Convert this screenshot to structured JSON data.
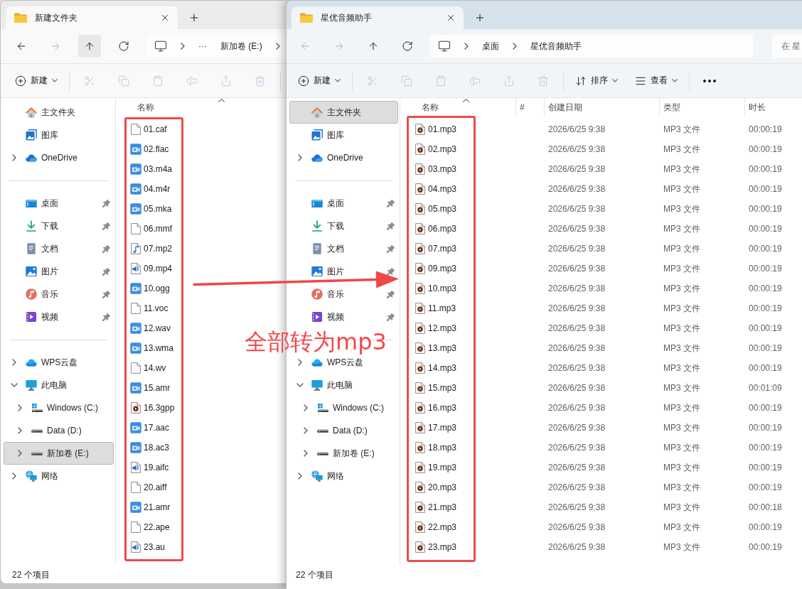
{
  "windows": [
    {
      "active": false,
      "tabs": [
        {
          "title": "新建文件夹",
          "selected": true
        }
      ],
      "nav_buttons": [
        {
          "kind": "back",
          "disabled": false,
          "hovered": false
        },
        {
          "kind": "forward",
          "disabled": true,
          "hovered": false
        },
        {
          "kind": "up",
          "disabled": false,
          "hovered": true
        },
        {
          "kind": "refresh",
          "disabled": false,
          "hovered": false
        }
      ],
      "address": [
        {
          "kind": "computer"
        },
        {
          "kind": "chevron"
        },
        {
          "kind": "overflow",
          "label": "···"
        },
        {
          "kind": "crumb",
          "label": "新加卷 (E:)"
        },
        {
          "kind": "chevron"
        }
      ],
      "command_bar": [
        {
          "kind": "new",
          "label": "新建",
          "disabled": false
        },
        {
          "kind": "separator"
        },
        {
          "kind": "cut",
          "disabled": true
        },
        {
          "kind": "copy",
          "disabled": true
        },
        {
          "kind": "paste",
          "disabled": true
        },
        {
          "kind": "rename",
          "disabled": true
        },
        {
          "kind": "share",
          "disabled": true
        },
        {
          "kind": "delete",
          "disabled": true
        },
        {
          "kind": "separator"
        }
      ],
      "sidebar": [
        {
          "items": [
            {
              "label": "主文件夹",
              "kind": "home",
              "selected": false
            },
            {
              "label": "图库",
              "kind": "gallery",
              "selected": false
            },
            {
              "label": "OneDrive",
              "kind": "onedrive",
              "selected": false,
              "expanded": false
            }
          ]
        },
        {
          "items": [
            {
              "label": "桌面",
              "kind": "desktop",
              "selected": false,
              "pinned": true
            },
            {
              "label": "下载",
              "kind": "downloads",
              "selected": false,
              "pinned": true
            },
            {
              "label": "文档",
              "kind": "documents",
              "selected": false,
              "pinned": true
            },
            {
              "label": "图片",
              "kind": "pictures",
              "selected": false,
              "pinned": true
            },
            {
              "label": "音乐",
              "kind": "music",
              "selected": false,
              "pinned": true
            },
            {
              "label": "视频",
              "kind": "videos",
              "selected": false,
              "pinned": true
            }
          ]
        },
        {
          "items": [
            {
              "label": "WPS云盘",
              "kind": "wps-cloud",
              "selected": false,
              "expanded": false
            },
            {
              "label": "此电脑",
              "kind": "pc",
              "selected": false,
              "expanded": true,
              "children": [
                {
                  "label": "Windows (C:)",
                  "kind": "system-drive",
                  "selected": false,
                  "expanded": false
                },
                {
                  "label": "Data (D:)",
                  "kind": "drive",
                  "selected": false,
                  "expanded": false
                },
                {
                  "label": "新加卷 (E:)",
                  "kind": "drive",
                  "selected": true,
                  "expanded": false
                }
              ]
            },
            {
              "label": "网络",
              "kind": "network",
              "selected": false,
              "expanded": false
            }
          ]
        }
      ],
      "file_list": {
        "name_column_marked": true,
        "columns": [
          {
            "kind": "name",
            "label": "名称",
            "sorted": true
          }
        ],
        "files": [
          {
            "name": "01.caf",
            "kind": "blank"
          },
          {
            "name": "02.flac",
            "kind": "media"
          },
          {
            "name": "03.m4a",
            "kind": "media"
          },
          {
            "name": "04.m4r",
            "kind": "media"
          },
          {
            "name": "05.mka",
            "kind": "media"
          },
          {
            "name": "06.mmf",
            "kind": "blank"
          },
          {
            "name": "07.mp2",
            "kind": "note"
          },
          {
            "name": "09.mp4",
            "kind": "speaker"
          },
          {
            "name": "10.ogg",
            "kind": "media"
          },
          {
            "name": "11.voc",
            "kind": "blank"
          },
          {
            "name": "12.wav",
            "kind": "media"
          },
          {
            "name": "13.wma",
            "kind": "media"
          },
          {
            "name": "14.wv",
            "kind": "blank"
          },
          {
            "name": "15.amr",
            "kind": "media"
          },
          {
            "name": "16.3gpp",
            "kind": "player"
          },
          {
            "name": "17.aac",
            "kind": "media"
          },
          {
            "name": "18.ac3",
            "kind": "media"
          },
          {
            "name": "19.aifc",
            "kind": "speaker"
          },
          {
            "name": "20.aiff",
            "kind": "blank"
          },
          {
            "name": "21.amr",
            "kind": "media"
          },
          {
            "name": "22.ape",
            "kind": "blank"
          },
          {
            "name": "23.au",
            "kind": "speaker"
          }
        ]
      },
      "status": "22 个项目"
    },
    {
      "active": true,
      "tabs": [
        {
          "title": "星优音频助手",
          "selected": true
        }
      ],
      "nav_buttons": [
        {
          "kind": "back",
          "disabled": true,
          "hovered": false
        },
        {
          "kind": "forward",
          "disabled": true,
          "hovered": false
        },
        {
          "kind": "up",
          "disabled": false,
          "hovered": false
        },
        {
          "kind": "refresh",
          "disabled": false,
          "hovered": false
        }
      ],
      "address": [
        {
          "kind": "computer"
        },
        {
          "kind": "chevron"
        },
        {
          "kind": "crumb",
          "label": "桌面"
        },
        {
          "kind": "chevron"
        },
        {
          "kind": "crumb",
          "label": "星优音频助手"
        }
      ],
      "search": {
        "placeholder": "在 星"
      },
      "command_bar": [
        {
          "kind": "new",
          "label": "新建",
          "disabled": false
        },
        {
          "kind": "separator"
        },
        {
          "kind": "cut",
          "disabled": true
        },
        {
          "kind": "copy",
          "disabled": true
        },
        {
          "kind": "paste",
          "disabled": true
        },
        {
          "kind": "rename",
          "disabled": true
        },
        {
          "kind": "share",
          "disabled": true
        },
        {
          "kind": "delete",
          "disabled": true
        },
        {
          "kind": "separator"
        },
        {
          "kind": "sort",
          "label": "排序",
          "disabled": false
        },
        {
          "kind": "view",
          "label": "查看",
          "disabled": false
        },
        {
          "kind": "separator"
        },
        {
          "kind": "more",
          "disabled": false
        }
      ],
      "sidebar": [
        {
          "items": [
            {
              "label": "主文件夹",
              "kind": "home",
              "selected": true
            },
            {
              "label": "图库",
              "kind": "gallery",
              "selected": false
            },
            {
              "label": "OneDrive",
              "kind": "onedrive",
              "selected": false,
              "expanded": false
            }
          ]
        },
        {
          "items": [
            {
              "label": "桌面",
              "kind": "desktop",
              "selected": false,
              "pinned": true
            },
            {
              "label": "下载",
              "kind": "downloads",
              "selected": false,
              "pinned": true
            },
            {
              "label": "文档",
              "kind": "documents",
              "selected": false,
              "pinned": true
            },
            {
              "label": "图片",
              "kind": "pictures",
              "selected": false,
              "pinned": true
            },
            {
              "label": "音乐",
              "kind": "music",
              "selected": false,
              "pinned": true
            },
            {
              "label": "视频",
              "kind": "videos",
              "selected": false,
              "pinned": true
            }
          ]
        },
        {
          "items": [
            {
              "label": "WPS云盘",
              "kind": "wps-cloud",
              "selected": false,
              "expanded": false
            },
            {
              "label": "此电脑",
              "kind": "pc",
              "selected": false,
              "expanded": true,
              "children": [
                {
                  "label": "Windows (C:)",
                  "kind": "system-drive",
                  "selected": false,
                  "expanded": false
                },
                {
                  "label": "Data (D:)",
                  "kind": "drive",
                  "selected": false,
                  "expanded": false
                },
                {
                  "label": "新加卷 (E:)",
                  "kind": "drive",
                  "selected": false,
                  "expanded": false
                }
              ]
            },
            {
              "label": "网络",
              "kind": "network",
              "selected": false,
              "expanded": false
            }
          ]
        }
      ],
      "file_list": {
        "name_column_marked": true,
        "columns": [
          {
            "kind": "name",
            "label": "名称",
            "sorted": true
          },
          {
            "kind": "number",
            "label": "#",
            "sorted": false
          },
          {
            "kind": "text",
            "label": "创建日期",
            "sorted": false
          },
          {
            "kind": "text",
            "label": "类型",
            "sorted": false
          },
          {
            "kind": "text",
            "label": "时长",
            "sorted": false
          }
        ],
        "files": [
          {
            "name": "01.mp3",
            "kind": "player",
            "details": [
              "2026/6/25 9:38",
              "MP3 文件",
              "00:00:19"
            ]
          },
          {
            "name": "02.mp3",
            "kind": "player",
            "details": [
              "2026/6/25 9:38",
              "MP3 文件",
              "00:00:19"
            ]
          },
          {
            "name": "03.mp3",
            "kind": "player",
            "details": [
              "2026/6/25 9:38",
              "MP3 文件",
              "00:00:19"
            ]
          },
          {
            "name": "04.mp3",
            "kind": "player",
            "details": [
              "2026/6/25 9:38",
              "MP3 文件",
              "00:00:19"
            ]
          },
          {
            "name": "05.mp3",
            "kind": "player",
            "details": [
              "2026/6/25 9:38",
              "MP3 文件",
              "00:00:19"
            ]
          },
          {
            "name": "06.mp3",
            "kind": "player",
            "details": [
              "2026/6/25 9:38",
              "MP3 文件",
              "00:00:19"
            ]
          },
          {
            "name": "07.mp3",
            "kind": "player",
            "details": [
              "2026/6/25 9:38",
              "MP3 文件",
              "00:00:19"
            ]
          },
          {
            "name": "09.mp3",
            "kind": "player",
            "details": [
              "2026/6/25 9:38",
              "MP3 文件",
              "00:00:19"
            ]
          },
          {
            "name": "10.mp3",
            "kind": "player",
            "details": [
              "2026/6/25 9:38",
              "MP3 文件",
              "00:00:19"
            ]
          },
          {
            "name": "11.mp3",
            "kind": "player",
            "details": [
              "2026/6/25 9:38",
              "MP3 文件",
              "00:00:19"
            ]
          },
          {
            "name": "12.mp3",
            "kind": "player",
            "details": [
              "2026/6/25 9:38",
              "MP3 文件",
              "00:00:19"
            ]
          },
          {
            "name": "13.mp3",
            "kind": "player",
            "details": [
              "2026/6/25 9:38",
              "MP3 文件",
              "00:00:19"
            ]
          },
          {
            "name": "14.mp3",
            "kind": "player",
            "details": [
              "2026/6/25 9:38",
              "MP3 文件",
              "00:00:19"
            ]
          },
          {
            "name": "15.mp3",
            "kind": "player",
            "details": [
              "2026/6/25 9:38",
              "MP3 文件",
              "00:01:09"
            ]
          },
          {
            "name": "16.mp3",
            "kind": "player",
            "details": [
              "2026/6/25 9:38",
              "MP3 文件",
              "00:00:19"
            ]
          },
          {
            "name": "17.mp3",
            "kind": "player",
            "details": [
              "2026/6/25 9:38",
              "MP3 文件",
              "00:00:19"
            ]
          },
          {
            "name": "18.mp3",
            "kind": "player",
            "details": [
              "2026/6/25 9:38",
              "MP3 文件",
              "00:00:19"
            ]
          },
          {
            "name": "19.mp3",
            "kind": "player",
            "details": [
              "2026/6/25 9:38",
              "MP3 文件",
              "00:00:19"
            ]
          },
          {
            "name": "20.mp3",
            "kind": "player",
            "details": [
              "2026/6/25 9:38",
              "MP3 文件",
              "00:00:19"
            ]
          },
          {
            "name": "21.mp3",
            "kind": "player",
            "details": [
              "2026/6/25 9:38",
              "MP3 文件",
              "00:00:18"
            ]
          },
          {
            "name": "22.mp3",
            "kind": "player",
            "details": [
              "2026/6/25 9:38",
              "MP3 文件",
              "00:00:19"
            ]
          },
          {
            "name": "23.mp3",
            "kind": "player",
            "details": [
              "2026/6/25 9:38",
              "MP3 文件",
              "00:00:19"
            ]
          }
        ]
      },
      "status": "22 个项目"
    }
  ],
  "annotations": [
    {
      "kind": "arrow"
    },
    {
      "kind": "caption",
      "text": "全部转为mp3"
    }
  ]
}
